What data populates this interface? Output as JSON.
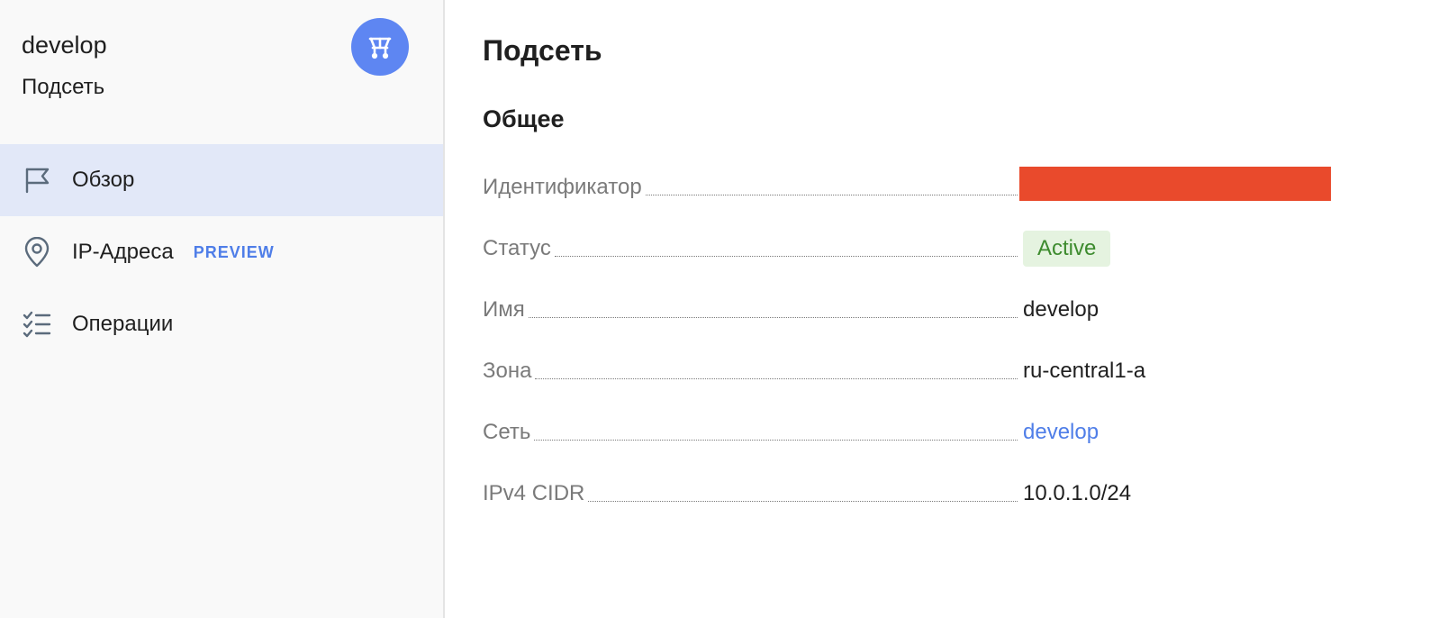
{
  "sidebar": {
    "resource_name": "develop",
    "resource_type": "Подсеть",
    "service_icon": "subnet-icon",
    "service_icon_color": "#5e86f2",
    "items": [
      {
        "label": "Обзор",
        "icon": "flag-icon",
        "active": true
      },
      {
        "label": "IP-Адреса",
        "icon": "location-pin-icon",
        "badge": "PREVIEW"
      },
      {
        "label": "Операции",
        "icon": "checklist-icon"
      }
    ]
  },
  "main": {
    "title": "Подсеть",
    "section_title": "Общее",
    "properties": [
      {
        "label": "Идентификатор",
        "value": "",
        "redacted": true,
        "redaction_color": "#e94a2c"
      },
      {
        "label": "Статус",
        "value": "Active",
        "status_color": "#3d8b2e"
      },
      {
        "label": "Имя",
        "value": "develop"
      },
      {
        "label": "Зона",
        "value": "ru-central1-a"
      },
      {
        "label": "Сеть",
        "value": "develop",
        "link": true,
        "link_color": "#4f7ee8"
      },
      {
        "label": "IPv4 CIDR",
        "value": "10.0.1.0/24"
      }
    ]
  },
  "colors": {
    "sidebar_bg": "#f9f9f9",
    "active_item_bg": "#e2e8f8",
    "accent": "#4f7ee8"
  }
}
